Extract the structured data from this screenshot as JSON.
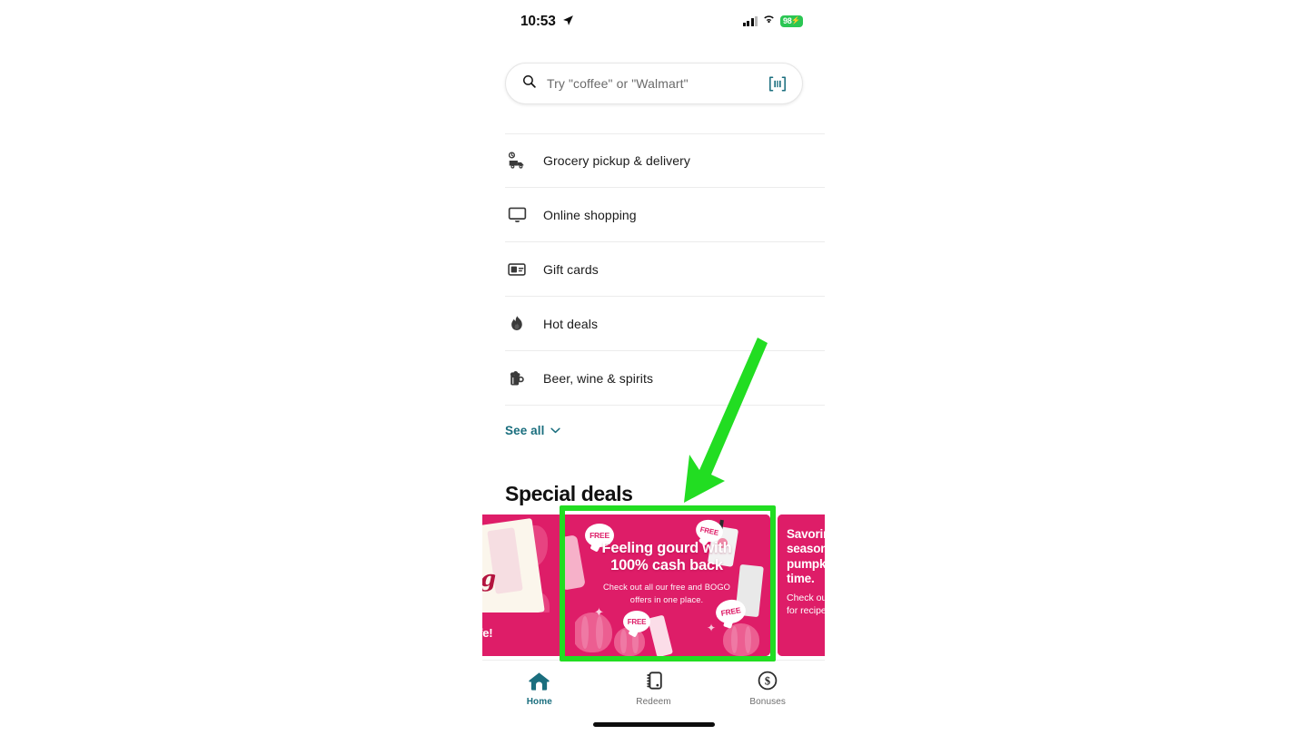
{
  "status_bar": {
    "time": "10:53",
    "location_icon": "location-arrow-icon",
    "signal_icon": "cellular-signal-icon",
    "wifi_icon": "wifi-icon",
    "battery_level": "98",
    "battery_charging_glyph": "⚡"
  },
  "search": {
    "placeholder": "Try \"coffee\" or \"Walmart\"",
    "value": "",
    "search_icon": "search-icon",
    "barcode_icon": "barcode-scanner-icon"
  },
  "menu": {
    "items": [
      {
        "label": "Grocery pickup & delivery",
        "icon": "delivery-truck-icon"
      },
      {
        "label": "Online shopping",
        "icon": "monitor-icon"
      },
      {
        "label": "Gift cards",
        "icon": "gift-card-icon"
      },
      {
        "label": "Hot deals",
        "icon": "flame-icon"
      },
      {
        "label": "Beer, wine & spirits",
        "icon": "beer-mug-icon"
      }
    ],
    "see_all_label": "See all",
    "see_all_icon": "chevron-down-icon"
  },
  "special_deals": {
    "section_title": "Special deals",
    "cards": [
      {
        "id": "card-left-partial",
        "visible_text_tail": "ing",
        "tagline_tail": "g for life!",
        "background_color": "#de1d68"
      },
      {
        "id": "card-feeling-gourd",
        "headline_line1": "Feeling gourd with",
        "headline_line2": "100% cash back",
        "subtext_line1": "Check out all our free and BOGO",
        "subtext_line2": "offers in one place.",
        "badge_label": "FREE",
        "badge_count": 4,
        "background_color": "#de1d68",
        "highlighted": true
      },
      {
        "id": "card-right-partial",
        "headline": "Savoring\nseasonal\npumpkin\ntime.",
        "subtext": "Check out\nfor recipes",
        "background_color": "#de1d68"
      }
    ]
  },
  "tab_bar": {
    "tabs": [
      {
        "label": "Home",
        "icon": "home-icon",
        "active": true
      },
      {
        "label": "Redeem",
        "icon": "receipt-icon",
        "active": false
      },
      {
        "label": "Bonuses",
        "icon": "dollar-circle-icon",
        "active": false
      }
    ],
    "active_color": "#1a6e7e",
    "inactive_color": "#6e6e6e"
  },
  "annotation": {
    "highlight_color": "#22dd22",
    "box_target": "card-feeling-gourd",
    "arrow_icon": "pointer-arrow-icon"
  }
}
